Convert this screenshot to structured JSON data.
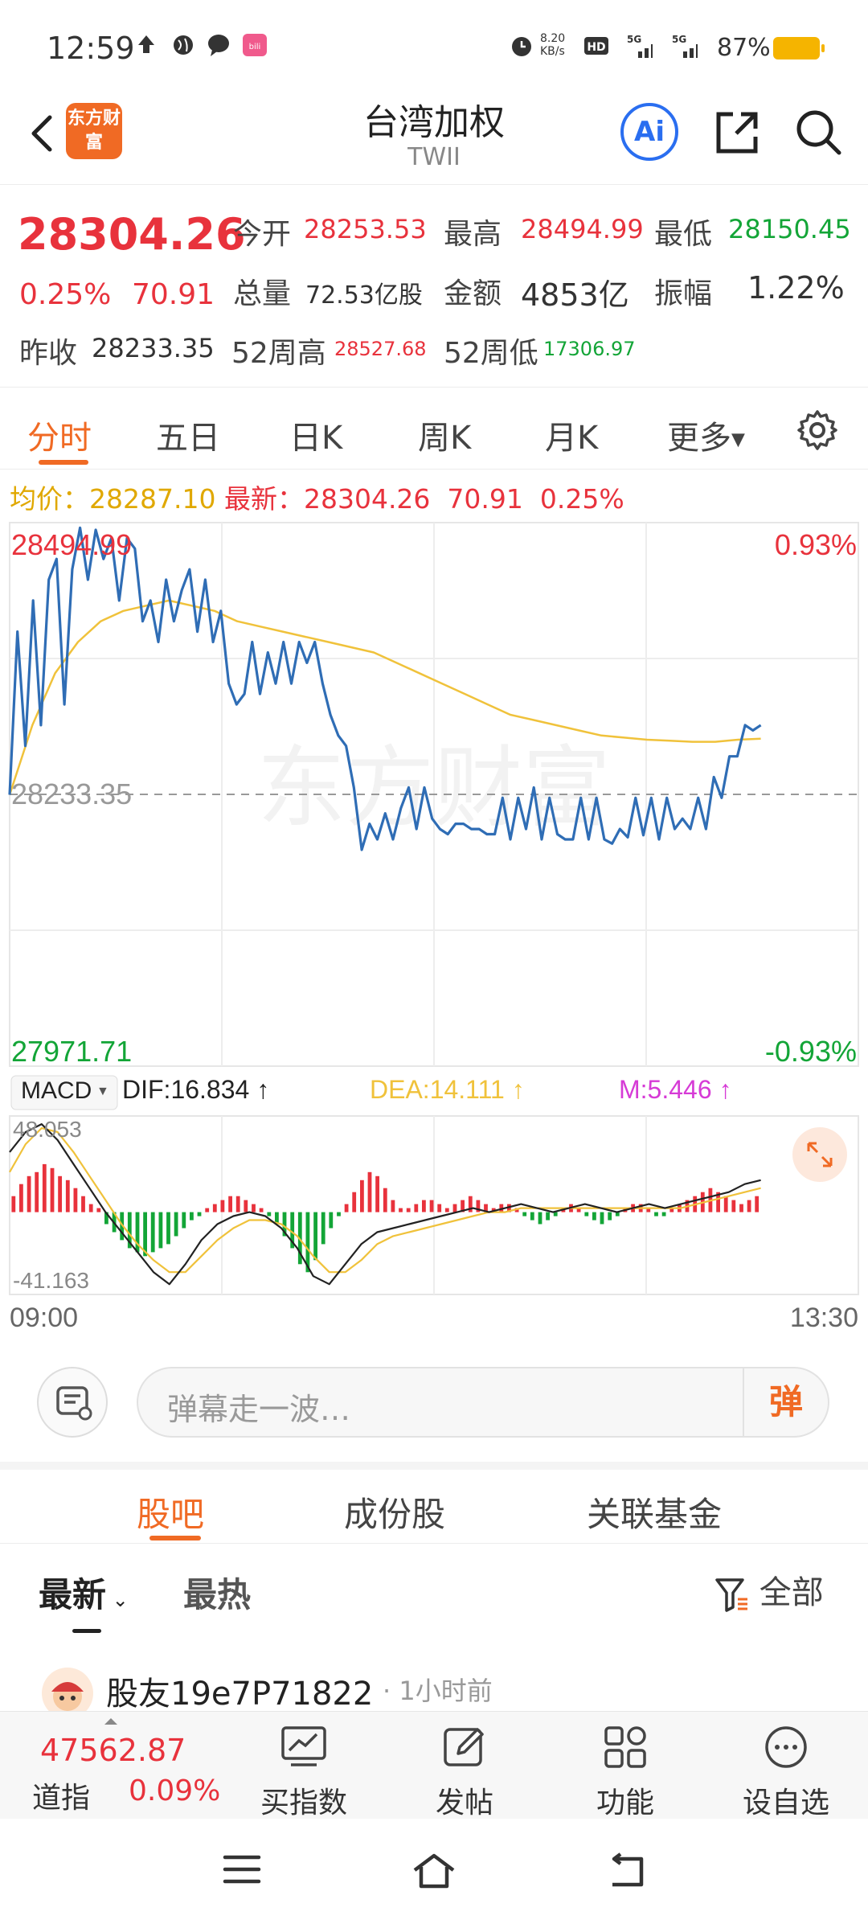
{
  "status_bar": {
    "time": "12:59",
    "net_speed": "8.20 KB/s",
    "battery": "87%"
  },
  "header": {
    "logo_text": "东方财富",
    "title": "台湾加权",
    "subtitle": "TWII",
    "ai_label": "Ai"
  },
  "quote": {
    "price": "28304.26",
    "change_pct": "0.25%",
    "change": "70.91",
    "open_label": "今开",
    "open": "28253.53",
    "high_label": "最高",
    "high": "28494.99",
    "low_label": "最低",
    "low": "28150.45",
    "volume_label": "总量",
    "volume": "72.53亿股",
    "amount_label": "金额",
    "amount": "4853亿",
    "amplitude_label": "振幅",
    "amplitude": "1.22%",
    "prev_close_label": "昨收",
    "prev_close": "28233.35",
    "w52_high_label": "52周高",
    "w52_high": "28527.68",
    "w52_low_label": "52周低",
    "w52_low": "17306.97"
  },
  "chart_tabs": [
    "分时",
    "五日",
    "日K",
    "周K",
    "月K",
    "更多"
  ],
  "chart_info": {
    "avg_label": "均价：",
    "avg": "28287.10",
    "latest_label": "最新：",
    "latest": "28304.26",
    "latest_change": "70.91",
    "latest_pct": "0.25%"
  },
  "colors": {
    "up": "#e8323c",
    "down": "#13a537",
    "price_line": "#2f6db5",
    "avg_line": "#f0c23b",
    "accent": "#f06a24",
    "dea": "#f0c23b",
    "macd_m": "#d63bd6"
  },
  "chart_data": [
    {
      "type": "line",
      "title": "",
      "x_start": "09:00",
      "x_end": "13:30",
      "ylim": [
        27971.71,
        28494.99
      ],
      "y_top_label": "28494.99",
      "y_bottom_label": "27971.71",
      "ref_label": "28233.35",
      "ref_value": 28233.35,
      "pct_top": "0.93%",
      "pct_bottom": "-0.93%",
      "grid": true,
      "series": [
        {
          "values": [
            28233,
            28390,
            28280,
            28420,
            28300,
            28440,
            28460,
            28320,
            28450,
            28490,
            28440,
            28488,
            28460,
            28480,
            28420,
            28480,
            28470,
            28400,
            28420,
            28380,
            28440,
            28400,
            28430,
            28450,
            28390,
            28440,
            28380,
            28410,
            28340,
            28320,
            28330,
            28380,
            28330,
            28370,
            28340,
            28380,
            28340,
            28380,
            28360,
            28380,
            28340,
            28310,
            28290,
            28280,
            28240,
            28180,
            28205,
            28190,
            28215,
            28190,
            28220,
            28240,
            28200,
            28240,
            28210,
            28200,
            28195,
            28205,
            28205,
            28200,
            28200,
            28195,
            28195,
            28230,
            28190,
            28230,
            28200,
            28240,
            28190,
            28230,
            28195,
            28190,
            28190,
            28230,
            28190,
            28230,
            28190,
            28186,
            28200,
            28192,
            28230,
            28194,
            28230,
            28190,
            28230,
            28200,
            28210,
            28200,
            28230,
            28200,
            28250,
            28230,
            28270,
            28270,
            28300,
            28295,
            28300
          ]
        },
        {
          "values": [
            28233,
            28300,
            28350,
            28380,
            28400,
            28410,
            28415,
            28420,
            28415,
            28410,
            28400,
            28395,
            28390,
            28385,
            28380,
            28375,
            28370,
            28360,
            28350,
            28340,
            28330,
            28320,
            28310,
            28305,
            28300,
            28295,
            28290,
            28288,
            28286,
            28285,
            28284,
            28284,
            28286,
            28287
          ]
        }
      ]
    },
    {
      "type": "bar",
      "title": "MACD",
      "ylim": [
        -41.163,
        48.053
      ],
      "y_top_label": "48.053",
      "y_bottom_label": "-41.163",
      "dif_label": "DIF:16.834",
      "dea_label": "DEA:14.111",
      "m_label": "M:5.446",
      "series": [
        {
          "values": [
            8,
            14,
            18,
            20,
            24,
            22,
            18,
            16,
            12,
            8,
            4,
            2,
            -6,
            -10,
            -14,
            -18,
            -20,
            -22,
            -20,
            -18,
            -16,
            -12,
            -8,
            -4,
            -2,
            2,
            4,
            6,
            8,
            8,
            6,
            4,
            2,
            -2,
            -6,
            -12,
            -18,
            -26,
            -30,
            -24,
            -16,
            -8,
            -2,
            4,
            10,
            16,
            20,
            18,
            12,
            6,
            2,
            2,
            4,
            6,
            6,
            4,
            2,
            4,
            6,
            8,
            6,
            4,
            2,
            4,
            4,
            2,
            -2,
            -4,
            -6,
            -4,
            -2,
            2,
            4,
            2,
            -2,
            -4,
            -6,
            -4,
            -2,
            2,
            4,
            4,
            2,
            -2,
            -2,
            2,
            4,
            6,
            8,
            10,
            12,
            10,
            8,
            6,
            4,
            6,
            8
          ]
        },
        {
          "name": "DIF",
          "values": [
            30,
            40,
            44,
            36,
            24,
            12,
            0,
            -10,
            -20,
            -30,
            -36,
            -26,
            -14,
            -6,
            -2,
            0,
            -2,
            -8,
            -18,
            -32,
            -36,
            -26,
            -16,
            -10,
            -8,
            -6,
            -4,
            -2,
            0,
            2,
            0,
            2,
            4,
            2,
            0,
            2,
            4,
            2,
            0,
            2,
            4,
            2,
            4,
            6,
            8,
            10,
            14,
            16
          ]
        },
        {
          "name": "DEA",
          "values": [
            20,
            34,
            42,
            40,
            30,
            18,
            6,
            -6,
            -16,
            -24,
            -30,
            -30,
            -22,
            -14,
            -8,
            -4,
            -4,
            -6,
            -12,
            -22,
            -30,
            -30,
            -24,
            -16,
            -12,
            -10,
            -8,
            -6,
            -4,
            -2,
            0,
            0,
            2,
            2,
            2,
            2,
            2,
            2,
            2,
            2,
            2,
            2,
            2,
            4,
            6,
            8,
            10,
            12
          ]
        }
      ]
    }
  ],
  "danmaku": {
    "placeholder": "弹幕走一波…",
    "send_label": "弹"
  },
  "section_tabs": [
    "股吧",
    "成份股",
    "关联基金"
  ],
  "sort": {
    "latest": "最新",
    "hot": "最热",
    "filter": "全部"
  },
  "post": {
    "user": "股友19e7P71822",
    "time": "· 1小时前"
  },
  "bottom_bar": {
    "dji_value": "47562.87",
    "dji_name": "道指",
    "dji_pct": "0.09%",
    "items": [
      "买指数",
      "发帖",
      "功能",
      "设自选"
    ]
  }
}
